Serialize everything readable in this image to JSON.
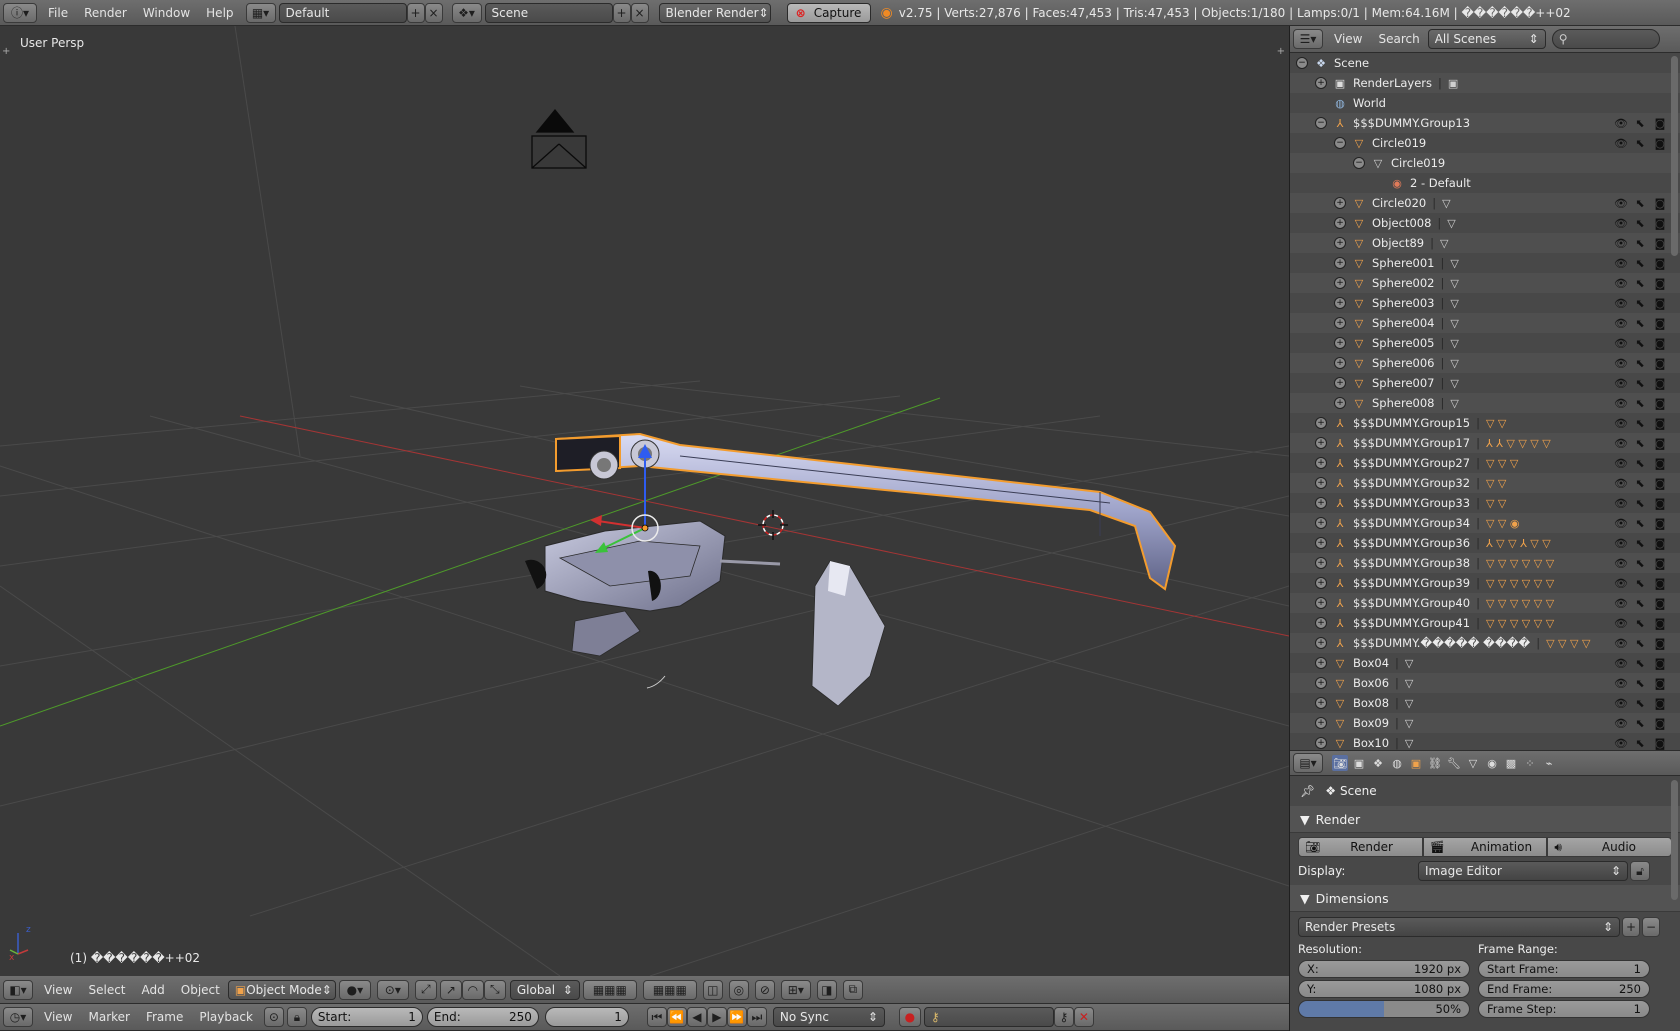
{
  "topbar": {
    "menus": [
      "File",
      "Render",
      "Window",
      "Help"
    ],
    "screen_layout": "Default",
    "scene": "Scene",
    "render_engine": "Blender Render",
    "capture_label": "Capture",
    "stats": "v2.75 | Verts:27,876 | Faces:47,453 | Tris:47,453 | Objects:1/180 | Lamps:0/1 | Mem:64.16M | ������++02"
  },
  "viewport": {
    "view_label": "User Persp",
    "frame_label": "(1) ������++02"
  },
  "viewport_header": {
    "menus": [
      "View",
      "Select",
      "Add",
      "Object"
    ],
    "mode": "Object Mode",
    "orientation": "Global"
  },
  "timeline": {
    "menus": [
      "View",
      "Marker",
      "Frame",
      "Playback"
    ],
    "start_label": "Start:",
    "start_value": "1",
    "end_label": "End:",
    "end_value": "250",
    "current_frame": "1",
    "sync": "No Sync"
  },
  "outliner": {
    "menus": [
      "View",
      "Search"
    ],
    "display_mode": "All Scenes",
    "rows": [
      {
        "name": "Scene",
        "indent": 0,
        "type": "scene",
        "expander": "−",
        "children": ""
      },
      {
        "name": "RenderLayers",
        "indent": 1,
        "type": "renderlayers",
        "expander": "+",
        "children": "▣"
      },
      {
        "name": "World",
        "indent": 1,
        "type": "world",
        "expander": "",
        "children": ""
      },
      {
        "name": "$$$DUMMY.Group13",
        "indent": 1,
        "type": "empty",
        "expander": "−",
        "children": "",
        "restrict": true
      },
      {
        "name": "Circle019",
        "indent": 2,
        "type": "mesh",
        "expander": "−",
        "children": "",
        "restrict": true
      },
      {
        "name": "Circle019",
        "indent": 3,
        "type": "meshdata",
        "expander": "−",
        "children": ""
      },
      {
        "name": "2 - Default",
        "indent": 4,
        "type": "material",
        "expander": "",
        "children": ""
      },
      {
        "name": "Circle020",
        "indent": 2,
        "type": "mesh",
        "expander": "+",
        "children": "▽",
        "restrict": true
      },
      {
        "name": "Object008",
        "indent": 2,
        "type": "mesh",
        "expander": "+",
        "children": "▽",
        "restrict": true
      },
      {
        "name": "Object89",
        "indent": 2,
        "type": "mesh",
        "expander": "+",
        "children": "▽",
        "restrict": true
      },
      {
        "name": "Sphere001",
        "indent": 2,
        "type": "mesh",
        "expander": "+",
        "children": "▽",
        "restrict": true
      },
      {
        "name": "Sphere002",
        "indent": 2,
        "type": "mesh",
        "expander": "+",
        "children": "▽",
        "restrict": true
      },
      {
        "name": "Sphere003",
        "indent": 2,
        "type": "mesh",
        "expander": "+",
        "children": "▽",
        "restrict": true
      },
      {
        "name": "Sphere004",
        "indent": 2,
        "type": "mesh",
        "expander": "+",
        "children": "▽",
        "restrict": true
      },
      {
        "name": "Sphere005",
        "indent": 2,
        "type": "mesh",
        "expander": "+",
        "children": "▽",
        "restrict": true
      },
      {
        "name": "Sphere006",
        "indent": 2,
        "type": "mesh",
        "expander": "+",
        "children": "▽",
        "restrict": true
      },
      {
        "name": "Sphere007",
        "indent": 2,
        "type": "mesh",
        "expander": "+",
        "children": "▽",
        "restrict": true
      },
      {
        "name": "Sphere008",
        "indent": 2,
        "type": "mesh",
        "expander": "+",
        "children": "▽",
        "restrict": true
      },
      {
        "name": "$$$DUMMY.Group15",
        "indent": 1,
        "type": "empty",
        "expander": "+",
        "children": "▽ ▽",
        "restrict": true
      },
      {
        "name": "$$$DUMMY.Group17",
        "indent": 1,
        "type": "empty",
        "expander": "+",
        "children": "⅄ ⅄ ▽ ▽ ▽ ▽",
        "restrict": true
      },
      {
        "name": "$$$DUMMY.Group27",
        "indent": 1,
        "type": "empty",
        "expander": "+",
        "children": "▽ ▽ ▽",
        "restrict": true
      },
      {
        "name": "$$$DUMMY.Group32",
        "indent": 1,
        "type": "empty",
        "expander": "+",
        "children": "▽ ▽",
        "restrict": true
      },
      {
        "name": "$$$DUMMY.Group33",
        "indent": 1,
        "type": "empty",
        "expander": "+",
        "children": "▽ ▽",
        "restrict": true
      },
      {
        "name": "$$$DUMMY.Group34",
        "indent": 1,
        "type": "empty",
        "expander": "+",
        "children": "▽ ▽ ◉",
        "restrict": true
      },
      {
        "name": "$$$DUMMY.Group36",
        "indent": 1,
        "type": "empty",
        "expander": "+",
        "children": "⅄ ▽ ▽ ⅄ ▽ ▽",
        "restrict": true
      },
      {
        "name": "$$$DUMMY.Group38",
        "indent": 1,
        "type": "empty",
        "expander": "+",
        "children": "▽ ▽ ▽ ▽ ▽ ▽",
        "restrict": true
      },
      {
        "name": "$$$DUMMY.Group39",
        "indent": 1,
        "type": "empty",
        "expander": "+",
        "children": "▽ ▽ ▽ ▽ ▽ ▽",
        "restrict": true
      },
      {
        "name": "$$$DUMMY.Group40",
        "indent": 1,
        "type": "empty",
        "expander": "+",
        "children": "▽ ▽ ▽ ▽ ▽ ▽",
        "restrict": true
      },
      {
        "name": "$$$DUMMY.Group41",
        "indent": 1,
        "type": "empty",
        "expander": "+",
        "children": "▽ ▽ ▽ ▽ ▽ ▽",
        "restrict": true
      },
      {
        "name": "$$$DUMMY.����� ����",
        "indent": 1,
        "type": "empty",
        "expander": "+",
        "children": "▽ ▽ ▽ ▽",
        "restrict": true
      },
      {
        "name": "Box04",
        "indent": 1,
        "type": "mesh",
        "expander": "+",
        "children": "▽",
        "restrict": true
      },
      {
        "name": "Box06",
        "indent": 1,
        "type": "mesh",
        "expander": "+",
        "children": "▽",
        "restrict": true
      },
      {
        "name": "Box08",
        "indent": 1,
        "type": "mesh",
        "expander": "+",
        "children": "▽",
        "restrict": true
      },
      {
        "name": "Box09",
        "indent": 1,
        "type": "mesh",
        "expander": "+",
        "children": "▽",
        "restrict": true
      },
      {
        "name": "Box10",
        "indent": 1,
        "type": "mesh",
        "expander": "+",
        "children": "▽",
        "restrict": true
      }
    ]
  },
  "properties": {
    "context": "Scene",
    "render_panel": "Render",
    "render_buttons": [
      "Render",
      "Animation",
      "Audio"
    ],
    "display_label": "Display:",
    "display_value": "Image Editor",
    "dimensions_panel": "Dimensions",
    "render_presets": "Render Presets",
    "resolution_label": "Resolution:",
    "res_x_label": "X:",
    "res_x_value": "1920 px",
    "res_y_label": "Y:",
    "res_y_value": "1080 px",
    "res_pct": "50%",
    "frame_range_label": "Frame Range:",
    "start_frame_label": "Start Frame:",
    "start_frame_value": "1",
    "end_frame_label": "End Frame:",
    "end_frame_value": "250",
    "frame_step_label": "Frame Step:",
    "frame_step_value": "1"
  },
  "colors": {
    "accent_orange": "#f0a24b",
    "selection_outline": "#f39c2e",
    "axis_x": "#c23b3b",
    "axis_y": "#6bb33b",
    "axis_z": "#3b5dc9"
  }
}
